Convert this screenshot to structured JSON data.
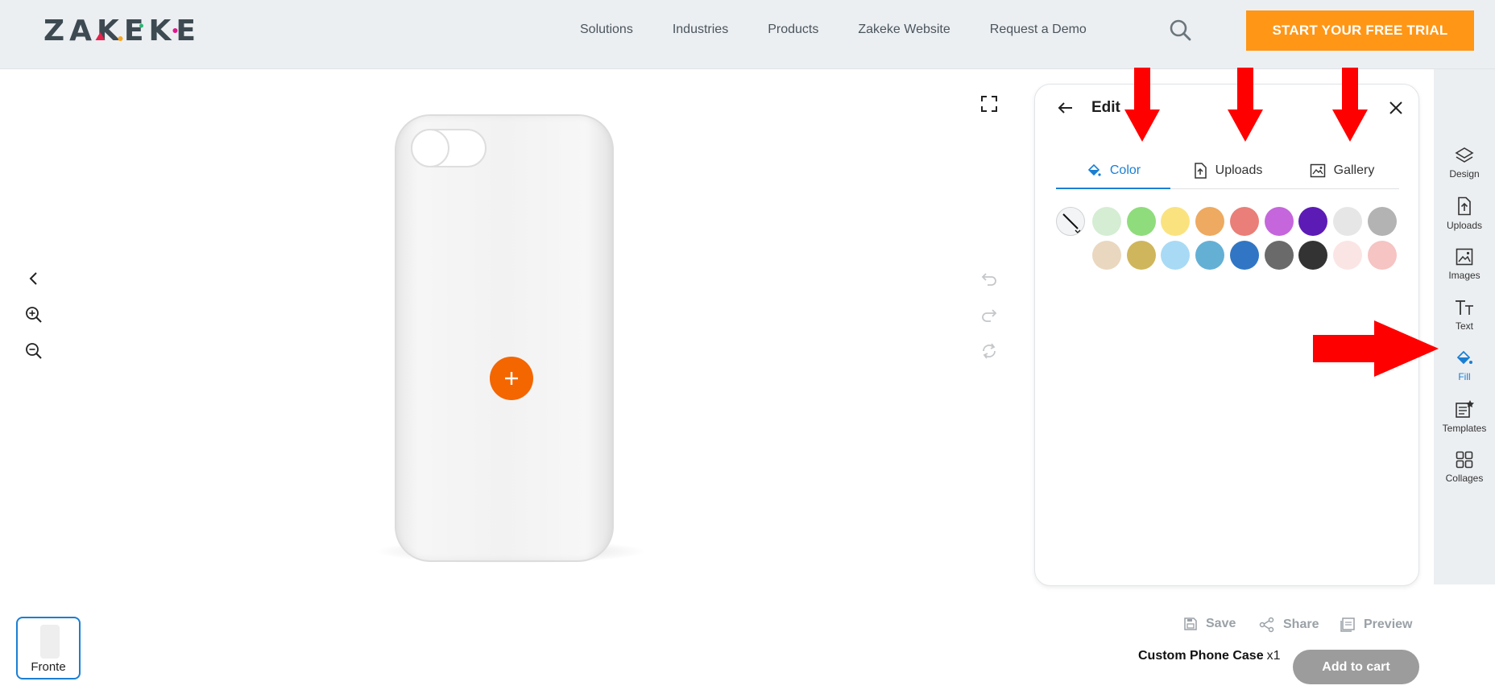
{
  "header": {
    "logo_text": "ZAKEKE",
    "nav": [
      {
        "label": "Solutions"
      },
      {
        "label": "Industries"
      },
      {
        "label": "Products"
      },
      {
        "label": "Zakeke Website"
      },
      {
        "label": "Request a Demo"
      }
    ],
    "trial_button": "START YOUR FREE TRIAL"
  },
  "panel": {
    "title": "Edit",
    "tabs": [
      {
        "label": "Color",
        "active": true
      },
      {
        "label": "Uploads"
      },
      {
        "label": "Gallery"
      }
    ],
    "swatch_colors_row1": [
      "#d5edd3",
      "#8fdc7c",
      "#fae37f",
      "#eeaa60",
      "#e97f78",
      "#c566dc",
      "#5c1bb5",
      "#e6e6e6",
      "#b3b3b3"
    ],
    "swatch_colors_row2": [
      "#ead7bf",
      "#cfb65c",
      "#a8daf5",
      "#64b0d5",
      "#3076c4",
      "#6a6a6a",
      "#333333",
      "#fbe5e4",
      "#f5c4c3"
    ]
  },
  "sidebar": {
    "items": [
      {
        "label": "Design",
        "icon": "layers-icon"
      },
      {
        "label": "Uploads",
        "icon": "upload-icon"
      },
      {
        "label": "Images",
        "icon": "image-icon"
      },
      {
        "label": "Text",
        "icon": "text-icon"
      },
      {
        "label": "Fill",
        "icon": "paint-bucket-icon",
        "active": true
      },
      {
        "label": "Templates",
        "icon": "template-icon"
      },
      {
        "label": "Collages",
        "icon": "grid-icon"
      }
    ]
  },
  "bottom": {
    "thumb_label": "Fronte",
    "save": "Save",
    "share": "Share",
    "preview": "Preview",
    "product_name": "Custom Phone Case",
    "quantity": "x1",
    "add_to_cart": "Add to cart"
  },
  "colors": {
    "accent": "#1a7fd3",
    "trial_orange": "#ff9616",
    "add_orange": "#f46600",
    "annotation_red": "#ff0000"
  }
}
